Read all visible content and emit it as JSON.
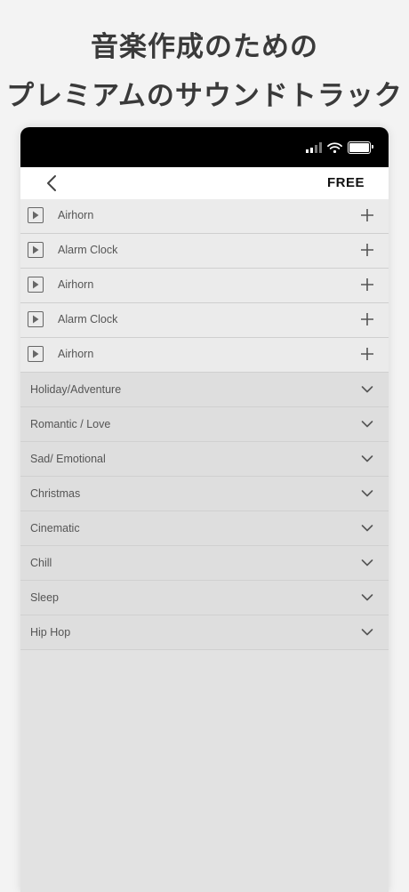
{
  "headline": {
    "line1": "音楽作成のための",
    "line2": "プレミアムのサウンドトラック"
  },
  "navbar": {
    "back_icon": "chevron-left-icon",
    "free_label": "FREE"
  },
  "tracks": [
    {
      "label": "Airhorn"
    },
    {
      "label": "Alarm Clock"
    },
    {
      "label": "Airhorn"
    },
    {
      "label": "Alarm Clock"
    },
    {
      "label": "Airhorn"
    }
  ],
  "categories": [
    {
      "label": "Holiday/Adventure"
    },
    {
      "label": "Romantic / Love"
    },
    {
      "label": "Sad/ Emotional"
    },
    {
      "label": "Christmas"
    },
    {
      "label": "Cinematic"
    },
    {
      "label": "Chill"
    },
    {
      "label": "Sleep"
    },
    {
      "label": "Hip Hop"
    }
  ],
  "colors": {
    "page_bg": "#f3f3f3",
    "status_bar": "#000000",
    "row_bg": "#ebebeb",
    "category_bg": "#dedede"
  }
}
